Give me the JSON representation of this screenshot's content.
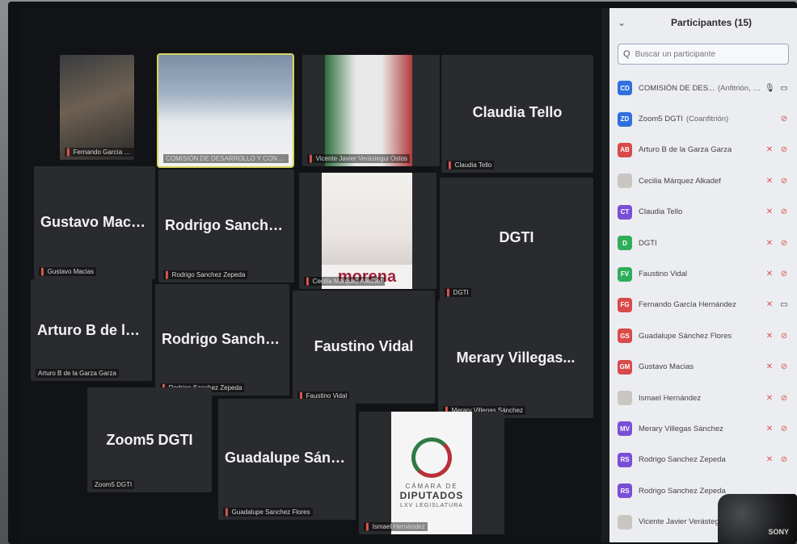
{
  "tiles": [
    {
      "id": "t1",
      "name": "",
      "label": "Fernando García Hernández"
    },
    {
      "id": "t2",
      "name": "",
      "label": "COMISIÓN DE DESARROLLO Y CONSERVACIÓN..."
    },
    {
      "id": "t3",
      "name": "",
      "label": "Vicente Javier Verástegui Ostos"
    },
    {
      "id": "t4",
      "name": "Claudia Tello",
      "label": "Claudia Tello"
    },
    {
      "id": "t5",
      "name": "Gustavo Macias",
      "label": "Gustavo Macias"
    },
    {
      "id": "t6",
      "name": "Rodrigo Sanche...",
      "label": "Rodrigo Sanchez Zepeda"
    },
    {
      "id": "t7",
      "name": "",
      "label": "Cecilia Márquez Alkadef",
      "overlay": "morena"
    },
    {
      "id": "t8",
      "name": "DGTI",
      "label": "DGTI"
    },
    {
      "id": "t9",
      "name": "Arturo B de la G...",
      "label": "Arturo B de la Garza Garza"
    },
    {
      "id": "t10",
      "name": "Rodrigo Sanche...",
      "label": "Rodrigo Sanchez Zepeda"
    },
    {
      "id": "t11",
      "name": "Faustino Vidal",
      "label": "Faustino Vidal"
    },
    {
      "id": "t12",
      "name": "Merary Villegas...",
      "label": "Merary Villegas Sánchez"
    },
    {
      "id": "t13",
      "name": "Zoom5 DGTI",
      "label": "Zoom5 DGTI"
    },
    {
      "id": "t14",
      "name": "Guadalupe Sánc...",
      "label": "Guadalupe Sanchez Flores"
    },
    {
      "id": "t15",
      "name": "",
      "label": "Ismael Hernández",
      "logo": {
        "top": "CÁMARA DE",
        "main": "DIPUTADOS",
        "sub": "LXV LEGISLATURA"
      }
    }
  ],
  "panel": {
    "title": "Participantes (15)",
    "search_placeholder": "Buscar un participante",
    "participants": [
      {
        "initials": "CD",
        "color": "#2f6fde",
        "name": "COMISIÓN DE DES...",
        "role": "(Anfitrión, yo)",
        "mic": "on",
        "cam": "on"
      },
      {
        "initials": "ZD",
        "color": "#2f6fde",
        "name": "Zoom5 DGTI",
        "role": "(Coanfitrión)",
        "mic": "",
        "cam": "off"
      },
      {
        "initials": "AB",
        "color": "#d94a4a",
        "name": "Arturo B de la Garza Garza",
        "role": "",
        "mic": "off",
        "cam": "off"
      },
      {
        "initials": "",
        "color": "",
        "name": "Cecilia Márquez Alkadef",
        "role": "",
        "mic": "off",
        "cam": "off"
      },
      {
        "initials": "CT",
        "color": "#7a4fd6",
        "name": "Claudia Tello",
        "role": "",
        "mic": "off",
        "cam": "off"
      },
      {
        "initials": "D",
        "color": "#2fae5a",
        "name": "DGTI",
        "role": "",
        "mic": "off",
        "cam": "off"
      },
      {
        "initials": "FV",
        "color": "#2fae5a",
        "name": "Faustino Vidal",
        "role": "",
        "mic": "off",
        "cam": "off"
      },
      {
        "initials": "FG",
        "color": "#d94a4a",
        "name": "Fernando García Hernández",
        "role": "",
        "mic": "off",
        "cam": "on"
      },
      {
        "initials": "GS",
        "color": "#d94a4a",
        "name": "Guadalupe Sánchez Flores",
        "role": "",
        "mic": "off",
        "cam": "off"
      },
      {
        "initials": "GM",
        "color": "#d94a4a",
        "name": "Gustavo Macias",
        "role": "",
        "mic": "off",
        "cam": "off"
      },
      {
        "initials": "",
        "color": "",
        "name": "Ismael Hernández",
        "role": "",
        "mic": "off",
        "cam": "off"
      },
      {
        "initials": "MV",
        "color": "#7a4fd6",
        "name": "Merary Villegas Sánchez",
        "role": "",
        "mic": "off",
        "cam": "off"
      },
      {
        "initials": "RS",
        "color": "#7a4fd6",
        "name": "Rodrigo Sanchez Zepeda",
        "role": "",
        "mic": "off",
        "cam": "off"
      },
      {
        "initials": "RS",
        "color": "#7a4fd6",
        "name": "Rodrigo Sanchez Zepeda",
        "role": "",
        "mic": "",
        "cam": ""
      },
      {
        "initials": "",
        "color": "",
        "name": "Vicente Javier Verástegui Ost...",
        "role": "",
        "mic": "",
        "cam": ""
      }
    ]
  },
  "camera_brand": "SONY"
}
